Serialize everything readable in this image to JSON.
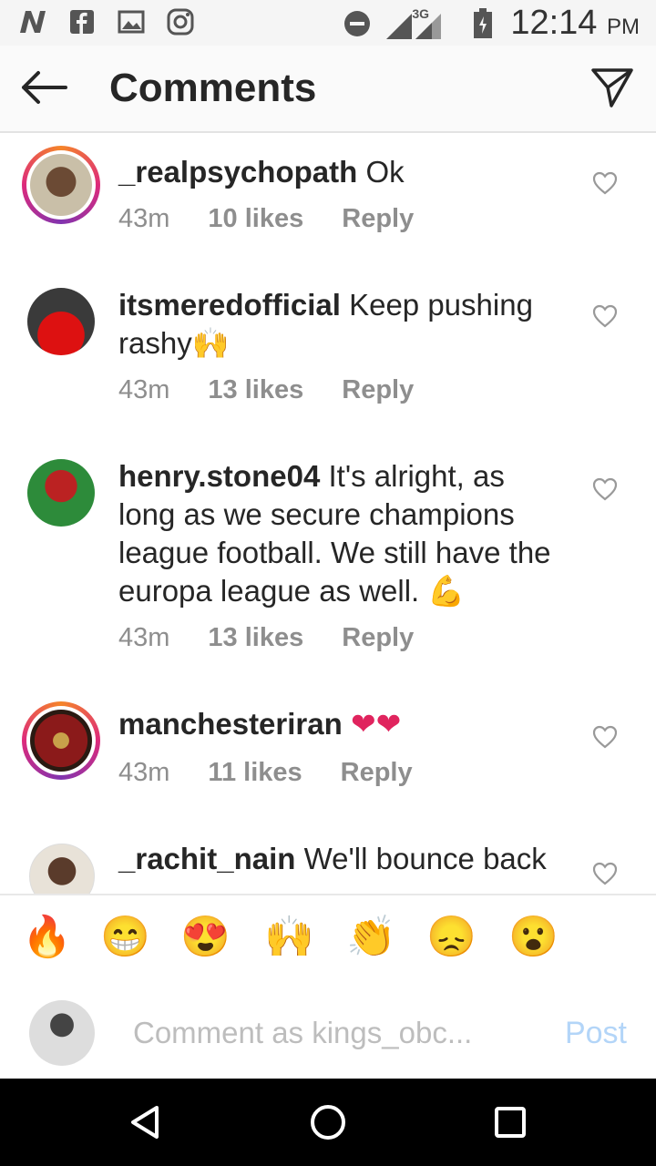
{
  "status_bar": {
    "time": "12:14",
    "ampm": "PM",
    "network": "3G",
    "icons": [
      "n-app-icon",
      "facebook-icon",
      "gallery-icon",
      "instagram-icon",
      "do-not-disturb-icon",
      "signal-icon",
      "battery-icon"
    ]
  },
  "header": {
    "title": "Comments",
    "back_icon": "back-arrow-icon",
    "share_icon": "direct-send-icon"
  },
  "comments": [
    {
      "user": "_realpsychopath",
      "text": "Ok",
      "time": "43m",
      "likes": "10 likes",
      "reply": "Reply",
      "story_ring": true
    },
    {
      "user": "itsmeredofficial",
      "text": "Keep pushing rashy🙌",
      "time": "43m",
      "likes": "13 likes",
      "reply": "Reply",
      "story_ring": false
    },
    {
      "user": "henry.stone04",
      "text": "It's alright, as long as we secure champions league football. We still have the europa league as well. 💪",
      "time": "43m",
      "likes": "13 likes",
      "reply": "Reply",
      "story_ring": false
    },
    {
      "user": "manchesteriran",
      "text": "❤❤",
      "time": "43m",
      "likes": "11 likes",
      "reply": "Reply",
      "story_ring": true
    },
    {
      "user": "_rachit_nain",
      "text": "We'll bounce back",
      "time": "",
      "likes": "",
      "reply": "",
      "story_ring": false
    }
  ],
  "emoji_bar": [
    "🔥",
    "😁",
    "😍",
    "🙌",
    "👏",
    "😞",
    "😮"
  ],
  "comment_box": {
    "placeholder": "Comment as kings_obc...",
    "post_label": "Post"
  },
  "nav": [
    "back-triangle-icon",
    "home-circle-icon",
    "recents-square-icon"
  ],
  "colors": {
    "accent_blue": "#b3d5f8",
    "meta_gray": "#8e8e8e",
    "heart_pink": "#e0245e"
  }
}
